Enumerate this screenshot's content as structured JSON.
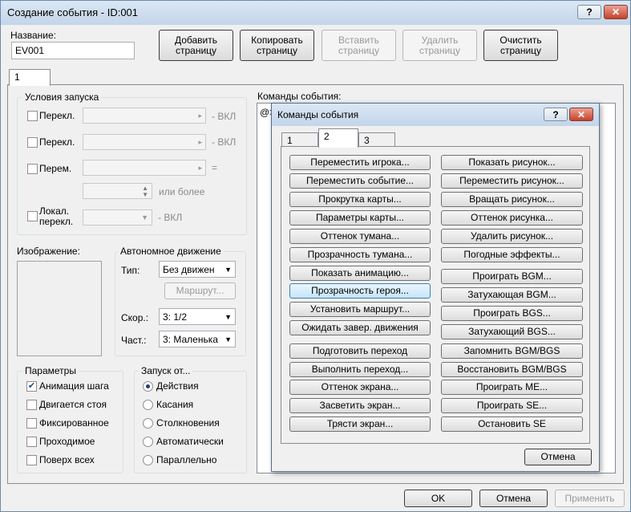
{
  "window": {
    "title": "Создание события - ID:001",
    "help_glyph": "?",
    "close_glyph": "✕"
  },
  "name_section": {
    "label": "Название:",
    "value": "EV001"
  },
  "toolbar": {
    "add_page": [
      "Добавить",
      "страницу"
    ],
    "copy_page": [
      "Копировать",
      "страницу"
    ],
    "paste_page": [
      "Вставить",
      "страницу"
    ],
    "delete_page": [
      "Удалить",
      "страницу"
    ],
    "clear_page": [
      "Очистить",
      "страницу"
    ]
  },
  "page_tab": "1",
  "conditions": {
    "title": "Условия запуска",
    "switch1_label": "Перекл.",
    "switch1_suffix": "- ВКЛ",
    "switch2_label": "Перекл.",
    "switch2_suffix": "- ВКЛ",
    "variable_label": "Перем.",
    "variable_eq": "=",
    "variable_more": "или более",
    "self_switch_label": [
      "Локал.",
      "перекл."
    ],
    "self_switch_suffix": "- ВКЛ"
  },
  "image": {
    "label": "Изображение:"
  },
  "autonomous": {
    "title": "Автономное движение",
    "type_label": "Тип:",
    "type_value": "Без движен",
    "route_button": "Маршрут...",
    "speed_label": "Скор.:",
    "speed_value": "3: 1/2",
    "freq_label": "Част.:",
    "freq_value": "3: Маленька"
  },
  "options": {
    "title": "Параметры",
    "items": [
      {
        "label": "Анимация шага",
        "checked": true
      },
      {
        "label": "Двигается стоя",
        "checked": false
      },
      {
        "label": "Фиксированное",
        "checked": false
      },
      {
        "label": "Проходимое",
        "checked": false
      },
      {
        "label": "Поверх всех",
        "checked": false
      }
    ]
  },
  "trigger": {
    "title": "Запуск от...",
    "items": [
      {
        "label": "Действия",
        "selected": true
      },
      {
        "label": "Касания",
        "selected": false
      },
      {
        "label": "Столкновения",
        "selected": false
      },
      {
        "label": "Автоматически",
        "selected": false
      },
      {
        "label": "Параллельно",
        "selected": false
      }
    ]
  },
  "commands": {
    "label": "Команды события:",
    "first_line": "@>"
  },
  "footer": {
    "ok": "OK",
    "cancel": "Отмена",
    "apply": "Применить"
  },
  "popup": {
    "title": "Команды события",
    "help_glyph": "?",
    "close_glyph": "✕",
    "tabs": [
      "1",
      "2",
      "3"
    ],
    "active_tab": "2",
    "left_col": [
      "Переместить игрока...",
      "Переместить событие...",
      "Прокрутка карты...",
      "Параметры карты...",
      "Оттенок тумана...",
      "Прозрачность тумана...",
      "Показать анимацию...",
      "Прозрачность героя...",
      "Установить маршрут...",
      "Ожидать завер. движения",
      "Подготовить переход",
      "Выполнить переход...",
      "Оттенок экрана...",
      "Засветить экран...",
      "Трясти экран..."
    ],
    "right_col": [
      "Показать рисунок...",
      "Переместить рисунок...",
      "Вращать рисунок...",
      "Оттенок рисунка...",
      "Удалить рисунок...",
      "Погодные эффекты...",
      "Проиграть BGM...",
      "Затухающая BGM...",
      "Проиграть BGS...",
      "Затухающий BGS...",
      "Запомнить BGM/BGS",
      "Восстановить BGM/BGS",
      "Проиграть ME...",
      "Проиграть SE...",
      "Остановить SE"
    ],
    "cancel": "Отмена"
  },
  "colors": {
    "title_gradient_top": "#dbe7f4",
    "close_red": "#c7412b",
    "focus_blue": "#3c7fb1"
  }
}
